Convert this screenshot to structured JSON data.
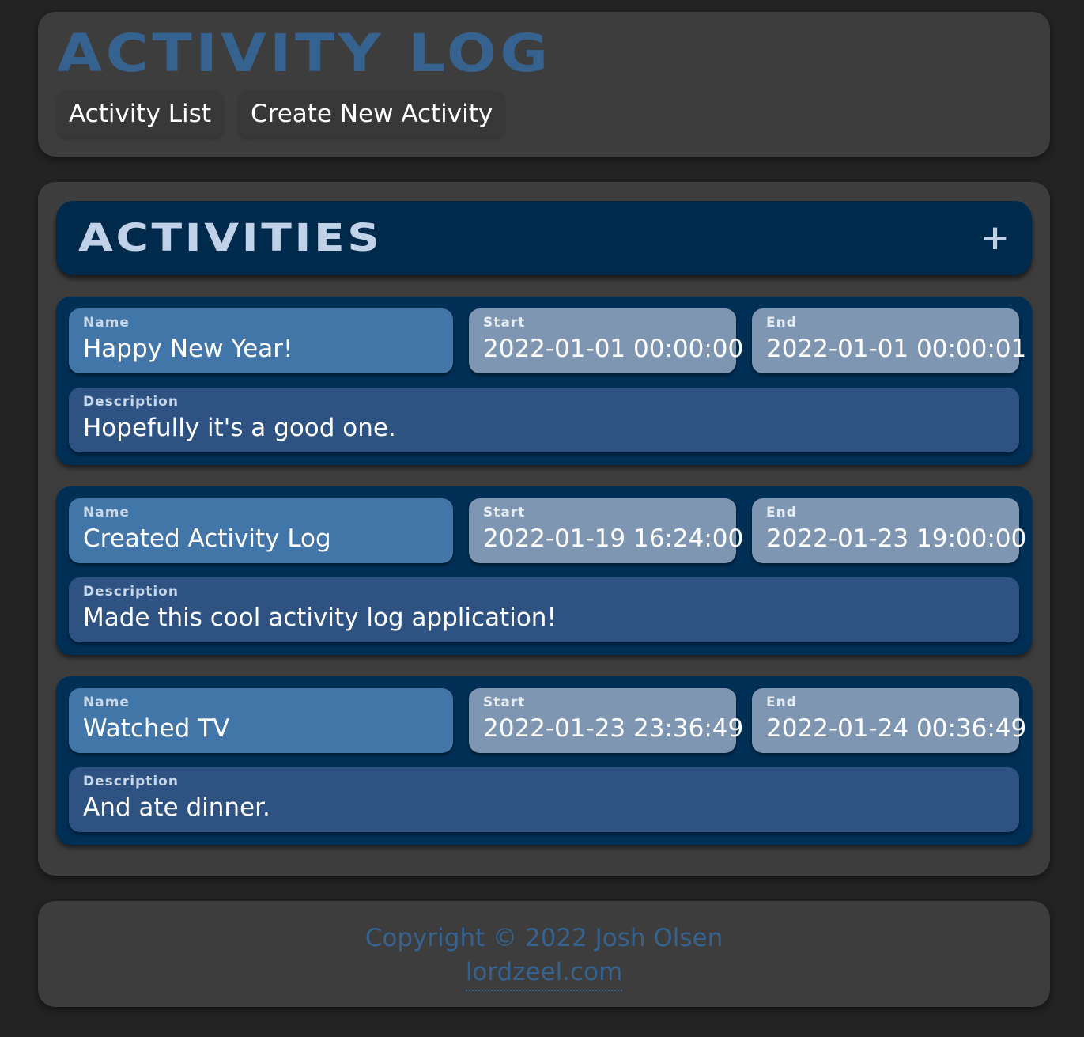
{
  "header": {
    "title": "ACTIVITY LOG",
    "nav": [
      {
        "label": "Activity List"
      },
      {
        "label": "Create New Activity"
      }
    ]
  },
  "activities_section": {
    "title": "ACTIVITIES",
    "add_label": "+",
    "labels": {
      "name": "Name",
      "start": "Start",
      "end": "End",
      "description": "Description"
    },
    "items": [
      {
        "name": "Happy New Year!",
        "start": "2022-01-01 00:00:00",
        "end": "2022-01-01 00:00:01",
        "description": "Hopefully it's a good one."
      },
      {
        "name": "Created Activity Log",
        "start": "2022-01-19 16:24:00",
        "end": "2022-01-23 19:00:00",
        "description": "Made this cool activity log application!"
      },
      {
        "name": "Watched TV",
        "start": "2022-01-23 23:36:49",
        "end": "2022-01-24 00:36:49",
        "description": "And ate dinner."
      }
    ]
  },
  "footer": {
    "copyright": "Copyright © 2022 Josh Olsen",
    "link": "lordzeel.com"
  },
  "colors": {
    "background": "#242424",
    "panel": "#3d3d3d",
    "accent": "#35628e",
    "section_header": "#002a4b",
    "card": "#002f55",
    "name_field": "#4275a8",
    "time_field": "#7f96b2",
    "description_field": "#2e5282"
  }
}
